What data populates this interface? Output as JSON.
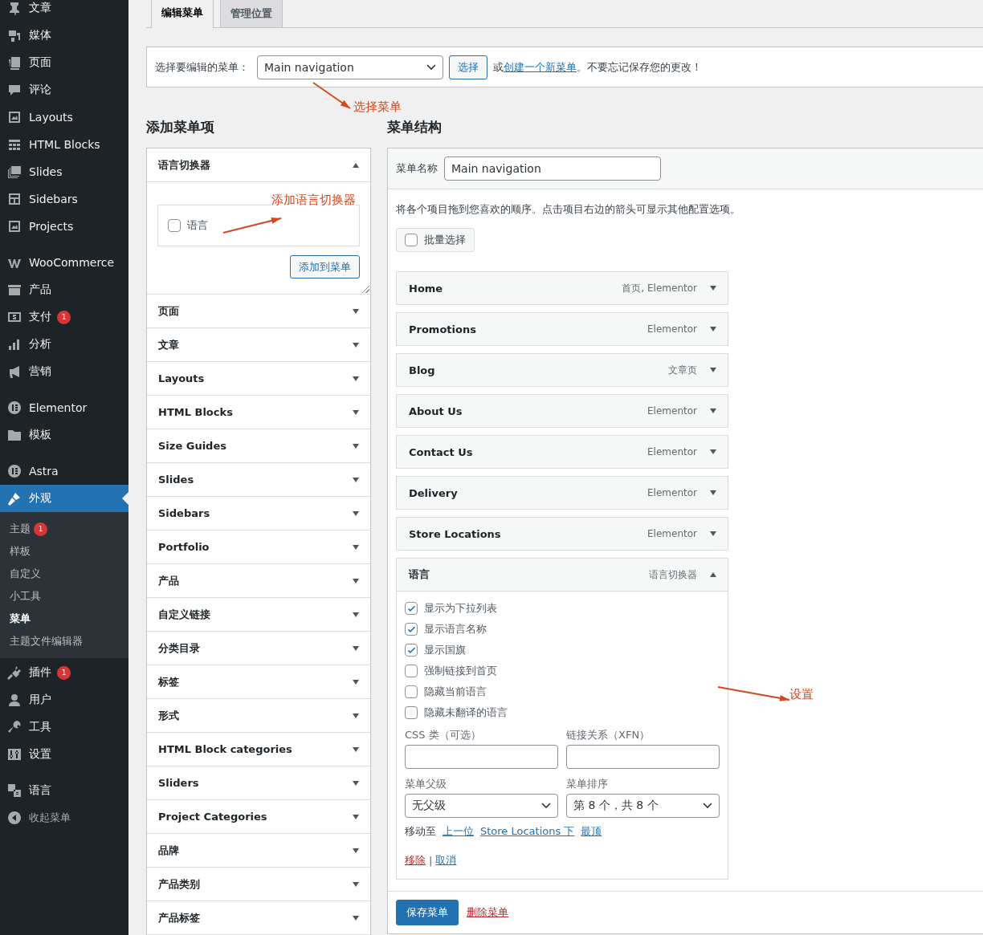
{
  "sidebar": {
    "groups": [
      [
        {
          "label": "文章",
          "selected": false
        },
        {
          "label": "媒体",
          "selected": false
        },
        {
          "label": "页面",
          "selected": false
        },
        {
          "label": "评论",
          "selected": false
        },
        {
          "label": "Layouts",
          "selected": false
        },
        {
          "label": "HTML Blocks",
          "selected": false
        },
        {
          "label": "Slides",
          "selected": false
        },
        {
          "label": "Sidebars",
          "selected": false
        },
        {
          "label": "Projects",
          "selected": false
        }
      ],
      [
        {
          "label": "WooCommerce",
          "selected": false
        },
        {
          "label": "产品",
          "selected": false
        },
        {
          "label": "支付",
          "badge": "1",
          "selected": false
        },
        {
          "label": "分析",
          "selected": false
        },
        {
          "label": "营销",
          "selected": false
        }
      ],
      [
        {
          "label": "Elementor",
          "selected": false
        },
        {
          "label": "模板",
          "selected": false
        }
      ],
      [
        {
          "label": "Astra",
          "selected": false
        },
        {
          "label": "外观",
          "selected": true,
          "children": [
            {
              "label": "主题",
              "badge": "1",
              "selected": false
            },
            {
              "label": "样板",
              "selected": false
            },
            {
              "label": "自定义",
              "selected": false
            },
            {
              "label": "小工具",
              "selected": false
            },
            {
              "label": "菜单",
              "selected": true
            },
            {
              "label": "主题文件编辑器",
              "selected": false
            }
          ]
        },
        {
          "label": "插件",
          "badge": "1",
          "selected": false
        },
        {
          "label": "用户",
          "selected": false
        },
        {
          "label": "工具",
          "selected": false
        },
        {
          "label": "设置",
          "selected": false
        }
      ],
      [
        {
          "label": "语言",
          "selected": false
        },
        {
          "label": "收起菜单",
          "selected": false,
          "kind": "collapse"
        }
      ]
    ]
  },
  "tabs": [
    {
      "label": "编辑菜单",
      "selected": true
    },
    {
      "label": "管理位置",
      "selected": false
    }
  ],
  "menu_select": {
    "label": "选择要编辑的菜单：",
    "value": "Main navigation",
    "button": "选择",
    "prefix": "或",
    "link": "创建一个新菜单",
    "suffix": "。不要忘记保存您的更改！"
  },
  "add_items": {
    "title": "添加菜单项",
    "panels": [
      {
        "title": "语言切换器",
        "expanded": true,
        "options": [
          {
            "label": "语言",
            "checked": false
          }
        ],
        "button": "添加到菜单"
      },
      {
        "title": "页面",
        "expanded": false
      },
      {
        "title": "文章",
        "expanded": false
      },
      {
        "title": "Layouts",
        "expanded": false
      },
      {
        "title": "HTML Blocks",
        "expanded": false
      },
      {
        "title": "Size Guides",
        "expanded": false
      },
      {
        "title": "Slides",
        "expanded": false
      },
      {
        "title": "Sidebars",
        "expanded": false
      },
      {
        "title": "Portfolio",
        "expanded": false
      },
      {
        "title": "产品",
        "expanded": false
      },
      {
        "title": "自定义链接",
        "expanded": false
      },
      {
        "title": "分类目录",
        "expanded": false
      },
      {
        "title": "标签",
        "expanded": false
      },
      {
        "title": "形式",
        "expanded": false
      },
      {
        "title": "HTML Block categories",
        "expanded": false
      },
      {
        "title": "Sliders",
        "expanded": false
      },
      {
        "title": "Project Categories",
        "expanded": false
      },
      {
        "title": "品牌",
        "expanded": false
      },
      {
        "title": "产品类别",
        "expanded": false
      },
      {
        "title": "产品标签",
        "expanded": false
      }
    ]
  },
  "structure": {
    "title": "菜单结构",
    "name_label": "菜单名称",
    "name_value": "Main navigation",
    "instructions": "将各个项目拖到您喜欢的顺序。点击项目右边的箭头可显示其他配置选项。",
    "bulk_select": {
      "label": "批量选择",
      "checked": false
    },
    "items": [
      {
        "title": "Home",
        "type": "首页, Elementor",
        "expanded": false
      },
      {
        "title": "Promotions",
        "type": "Elementor",
        "expanded": false
      },
      {
        "title": "Blog",
        "type": "文章页",
        "expanded": false
      },
      {
        "title": "About Us",
        "type": "Elementor",
        "expanded": false
      },
      {
        "title": "Contact Us",
        "type": "Elementor",
        "expanded": false
      },
      {
        "title": "Delivery",
        "type": "Elementor",
        "expanded": false
      },
      {
        "title": "Store Locations",
        "type": "Elementor",
        "expanded": false
      },
      {
        "title": "语言",
        "type": "语言切换器",
        "expanded": true,
        "settings": {
          "options": [
            {
              "label": "显示为下拉列表",
              "checked": true
            },
            {
              "label": "显示语言名称",
              "checked": true
            },
            {
              "label": "显示国旗",
              "checked": true
            },
            {
              "label": "强制链接到首页",
              "checked": false
            },
            {
              "label": "隐藏当前语言",
              "checked": false
            },
            {
              "label": "隐藏未翻译的语言",
              "checked": false
            }
          ],
          "css_label": "CSS 类（可选）",
          "xfn_label": "链接关系（XFN）",
          "parent_label": "菜单父级",
          "parent_value": "无父级",
          "order_label": "菜单排序",
          "order_value": "第 8 个，共 8 个",
          "move_label": "移动至",
          "move_links": [
            "上一位",
            "Store Locations 下",
            "最顶"
          ],
          "remove": "移除",
          "separator": "|",
          "cancel": "取消"
        }
      }
    ]
  },
  "footer": {
    "save": "保存菜单",
    "delete": "删除菜单"
  },
  "annotations": [
    {
      "text": "选择菜单"
    },
    {
      "text": "添加语言切换器"
    },
    {
      "text": "设置"
    }
  ]
}
